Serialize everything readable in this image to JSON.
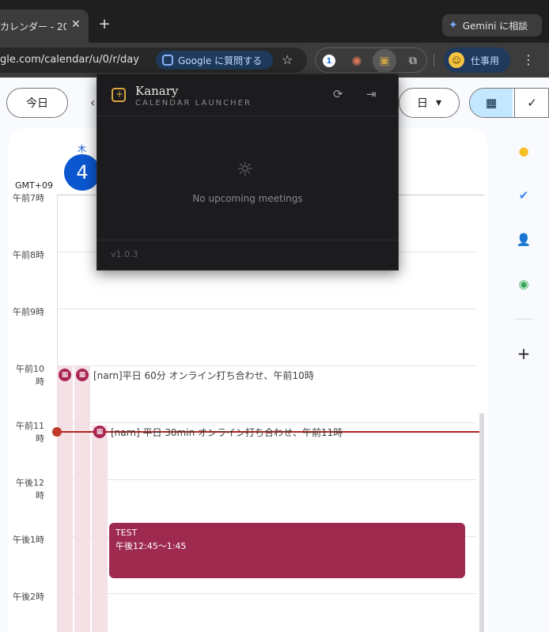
{
  "browser": {
    "tab_title": "カレンダー - 20",
    "tab_close": "✕",
    "new_tab": "+",
    "gemini_label": "Gemini に相談",
    "url": "gle.com/calendar/u/0/r/day",
    "lens_label": "Google に質問する",
    "bookmark_icon": "☆",
    "profile_label": "仕事用",
    "menu_icon": "⋮"
  },
  "calendar": {
    "today_button": "今日",
    "nav_prev": "‹",
    "view_label": "日",
    "view_caret": "▾",
    "day_of_week": "木",
    "day_number": "4",
    "timezone": "GMT+09",
    "hours": [
      "午前7時",
      "午前8時",
      "午前9時",
      "午前10時",
      "午前11時",
      "午後12時",
      "午後1時",
      "午後2時"
    ],
    "events": {
      "e1": "[narn]平日 60分 オンライン打ち合わせ、午前10時",
      "e2": "[narn] 平日 30min オンライン打ち合わせ、午前11時",
      "test_title": "TEST",
      "test_time": "午後12:45〜1:45"
    },
    "event_color": "#9e2a50",
    "now_color": "#b3261e"
  },
  "side_panel": {
    "add_icon": "+"
  },
  "kanary": {
    "title": "Kanary",
    "subtitle": "CALENDAR LAUNCHER",
    "empty_text": "No upcoming meetings",
    "version": "v1.0.3",
    "accent": "#d9a441"
  }
}
